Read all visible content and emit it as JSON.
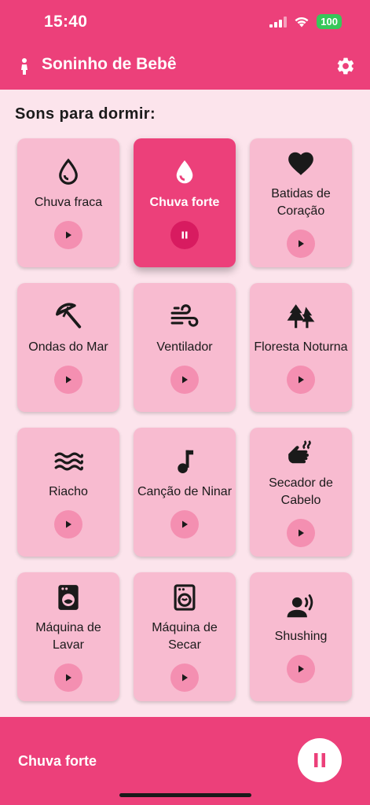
{
  "status_bar": {
    "time": "15:40",
    "battery": "100"
  },
  "app_bar": {
    "title": "Soninho de Bebê"
  },
  "section_title": "Sons para dormir:",
  "sounds": [
    {
      "label": "Chuva fraca",
      "icon": "water-drop-outline-icon",
      "state": "play"
    },
    {
      "label": "Chuva forte",
      "icon": "water-drop-filled-icon",
      "state": "pause",
      "active": true
    },
    {
      "label": "Batidas de Coração",
      "icon": "heart-icon",
      "state": "play"
    },
    {
      "label": "Ondas do Mar",
      "icon": "beach-umbrella-icon",
      "state": "play"
    },
    {
      "label": "Ventilador",
      "icon": "wind-icon",
      "state": "play"
    },
    {
      "label": "Floresta Noturna",
      "icon": "forest-icon",
      "state": "play"
    },
    {
      "label": "Riacho",
      "icon": "waves-icon",
      "state": "play"
    },
    {
      "label": "Canção de Ninar",
      "icon": "music-note-icon",
      "state": "play"
    },
    {
      "label": "Secador de Cabelo",
      "icon": "dry-hand-icon",
      "state": "play"
    },
    {
      "label": "Máquina de Lavar",
      "icon": "washing-machine-icon",
      "state": "play"
    },
    {
      "label": "Máquina de Secar",
      "icon": "dryer-icon",
      "state": "play"
    },
    {
      "label": "Shushing",
      "icon": "person-voice-icon",
      "state": "play"
    }
  ],
  "now_playing": {
    "title": "Chuva forte",
    "state": "pause"
  },
  "colors": {
    "primary": "#ec407a",
    "card": "#f8bbd0",
    "button": "#f48fb1",
    "active_button": "#d81b60",
    "background": "#fce4ec"
  }
}
